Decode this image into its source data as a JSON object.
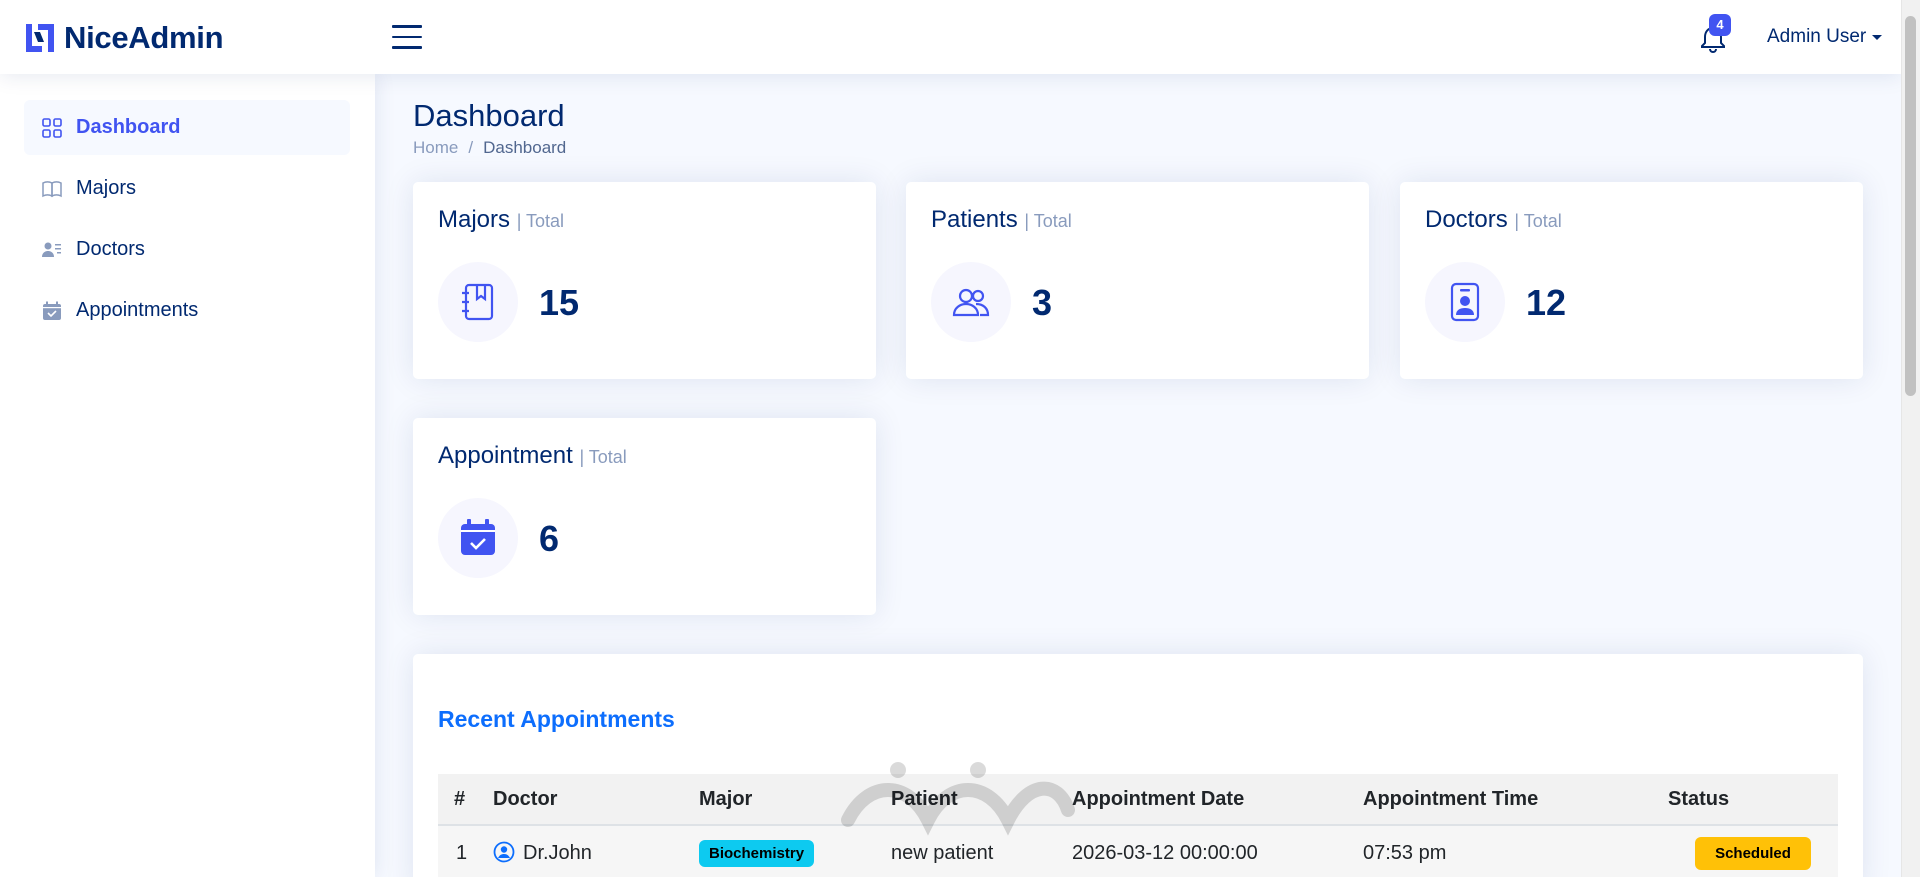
{
  "header": {
    "brand": "NiceAdmin",
    "notification_count": "4",
    "user_name": "Admin User"
  },
  "sidebar": {
    "items": [
      {
        "label": "Dashboard",
        "icon": "grid-icon",
        "active": true
      },
      {
        "label": "Majors",
        "icon": "book-icon"
      },
      {
        "label": "Doctors",
        "icon": "person-lines-icon"
      },
      {
        "label": "Appointments",
        "icon": "calendar-check-icon"
      }
    ]
  },
  "page": {
    "title": "Dashboard",
    "breadcrumb": [
      "Home",
      "/",
      "Dashboard"
    ]
  },
  "cards": [
    {
      "title": "Majors",
      "subtitle": "| Total",
      "value": "15",
      "icon": "journal-bookmark-icon"
    },
    {
      "title": "Patients",
      "subtitle": "| Total",
      "value": "3",
      "icon": "people-icon"
    },
    {
      "title": "Doctors",
      "subtitle": "| Total",
      "value": "12",
      "icon": "person-badge-icon"
    },
    {
      "title": "Appointment",
      "subtitle": "| Total",
      "value": "6",
      "icon": "calendar-check-fill-icon"
    }
  ],
  "recent": {
    "title": "Recent Appointments",
    "columns": [
      "#",
      "Doctor",
      "Major",
      "Patient",
      "Appointment Date",
      "Appointment Time",
      "Status"
    ],
    "rows": [
      {
        "num": "1",
        "doctor": "Dr.John",
        "major": "Biochemistry",
        "patient": "new patient",
        "date": "2026-03-12 00:00:00",
        "time": "07:53 pm",
        "status": "Scheduled"
      }
    ]
  },
  "colors": {
    "primary": "#4154f1",
    "navy": "#012970",
    "link": "#0d6efd",
    "info": "#0dcaf0",
    "warning": "#ffc107"
  }
}
